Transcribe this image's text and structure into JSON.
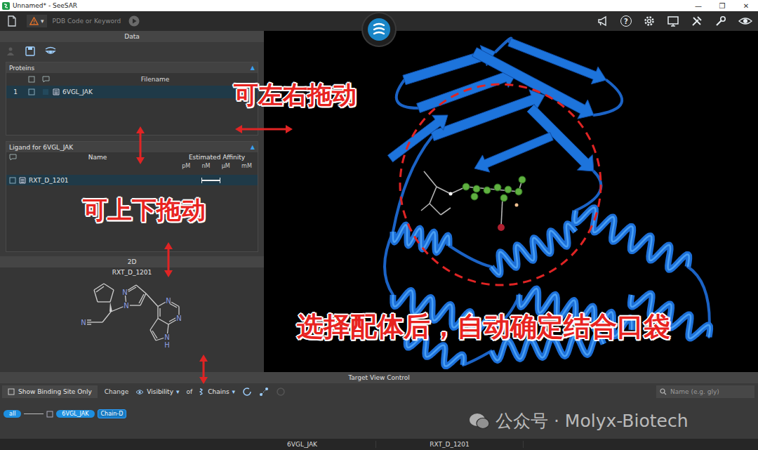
{
  "window": {
    "title": "Unnamed* - SeeSAR",
    "controls": [
      "—",
      "❐",
      "✕"
    ]
  },
  "toolbar": {
    "search_placeholder": "PDB Code or Keyword",
    "arrow": "▾",
    "help": "?"
  },
  "data_panel": {
    "title": "Data",
    "proteins": {
      "title": "Proteins",
      "collapse": "▲",
      "column": "Filename",
      "rows": [
        {
          "index": "1",
          "name": "6VGL_JAK",
          "selected": true
        }
      ]
    },
    "ligands": {
      "title": "Ligand for 6VGL_JAK",
      "collapse": "▲",
      "columns": {
        "name": "Name",
        "affinity": "Estimated Affinity"
      },
      "scale": [
        "pM",
        "nM",
        "μM",
        "mM"
      ],
      "rows": [
        {
          "name": "RXT_D_1201",
          "selected": true,
          "level_from": 0.31,
          "level_to": 0.53
        }
      ]
    },
    "structure": {
      "title": "2D",
      "name": "RXT_D_1201",
      "atoms": [
        "N",
        "N",
        "N",
        "N",
        "N",
        "H",
        "N"
      ]
    }
  },
  "target_view": {
    "title": "Target View Control",
    "show_binding_site_only": "Show Binding Site Only",
    "change": "Change",
    "visibility": "Visibility",
    "of": "of",
    "chains": "Chains",
    "arrow": "▾",
    "search_placeholder": "Name (e.g. gly)",
    "chips": [
      {
        "label": "all",
        "selected": true
      },
      {
        "label": "6VGL_JAK",
        "selected": true
      },
      {
        "label": "Chain-D",
        "selected": false
      }
    ]
  },
  "status_bar": [
    "6VGL_JAK",
    "RXT_D_1201"
  ],
  "annotations": [
    {
      "text": "可左右拖动"
    },
    {
      "text": "可上下拖动"
    },
    {
      "text": "选择配体后，自动确定结合口袋"
    }
  ],
  "watermark": "公众号 · Molyx-Biotech"
}
